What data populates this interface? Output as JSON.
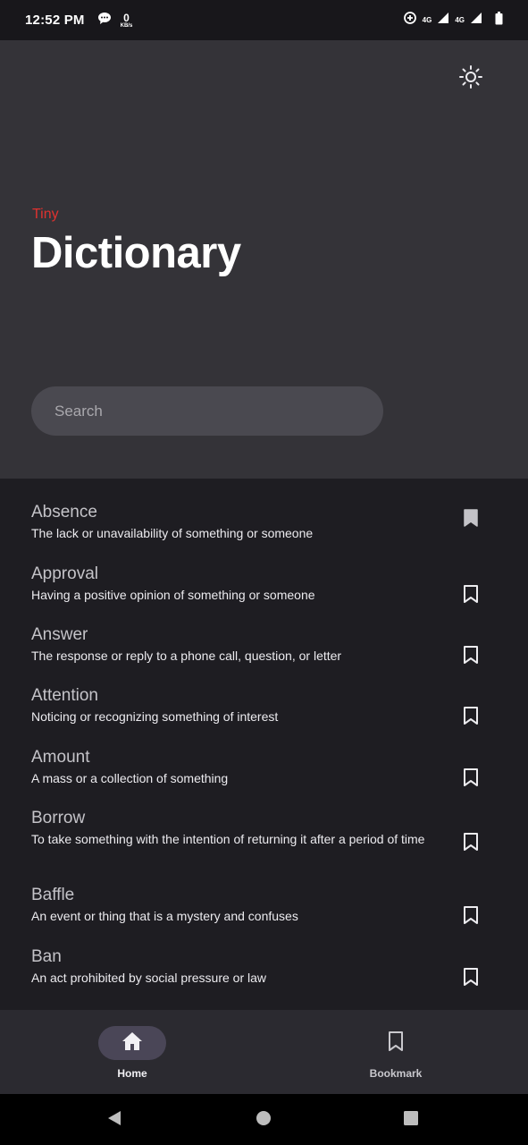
{
  "status_bar": {
    "time": "12:52 PM",
    "net_speed_value": "0",
    "net_speed_unit": "KB/s",
    "network_label_1": "4G",
    "network_label_2": "4G",
    "icons": [
      "chat-bubble-icon",
      "data-saver-icon",
      "signal-icon",
      "signal-icon",
      "battery-icon"
    ]
  },
  "header": {
    "brand_small": "Tiny",
    "title": "Dictionary",
    "theme_icon": "sun-icon"
  },
  "search": {
    "placeholder": "Search",
    "value": ""
  },
  "words": [
    {
      "word": "Absence",
      "definition": "The lack or unavailability of something or someone",
      "bookmarked": true
    },
    {
      "word": "Approval",
      "definition": "Having a positive opinion of something or someone",
      "bookmarked": false
    },
    {
      "word": "Answer",
      "definition": "The response or reply to a phone call, question, or letter",
      "bookmarked": false
    },
    {
      "word": "Attention",
      "definition": "Noticing or recognizing something of interest",
      "bookmarked": false
    },
    {
      "word": "Amount",
      "definition": "A mass or a collection of something",
      "bookmarked": false
    },
    {
      "word": "Borrow",
      "definition": "To take something with the intention of returning it after a period of time",
      "bookmarked": false
    },
    {
      "word": "Baffle",
      "definition": "An event or thing that is a mystery and confuses",
      "bookmarked": false
    },
    {
      "word": "Ban",
      "definition": "An act prohibited by social pressure or law",
      "bookmarked": false
    }
  ],
  "bottom_nav": {
    "home_label": "Home",
    "bookmark_label": "Bookmark",
    "active": "home"
  },
  "colors": {
    "accent": "#e0322f",
    "header_bg": "#343338",
    "list_bg": "#1e1d22",
    "nav_active_pill": "#4a4657"
  }
}
